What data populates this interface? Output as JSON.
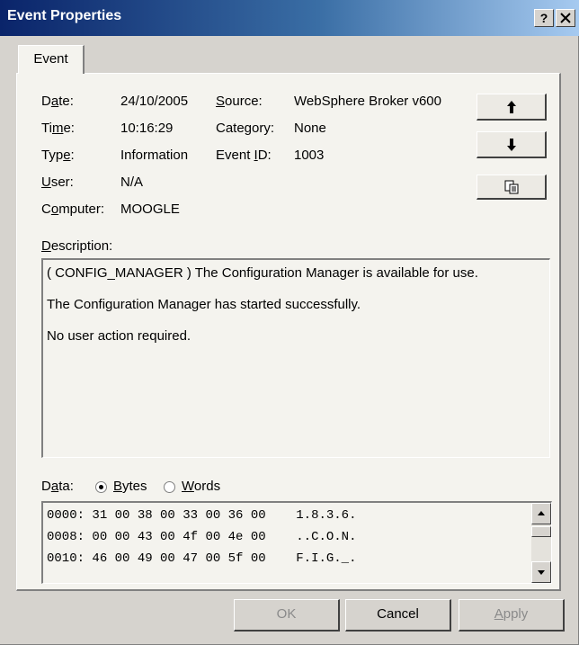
{
  "window": {
    "title": "Event Properties",
    "help_label": "?",
    "close_label": "✕"
  },
  "tab": {
    "label": "Event"
  },
  "fields": {
    "date_label": "Date:",
    "date_value": "24/10/2005",
    "time_label": "Time:",
    "time_value": "10:16:29",
    "type_label": "Type:",
    "type_value": "Information",
    "user_label": "User:",
    "user_value": "N/A",
    "computer_label": "Computer:",
    "computer_value": "MOOGLE",
    "source_label": "Source:",
    "source_value": "WebSphere Broker v600",
    "category_label": "Category:",
    "category_value": "None",
    "eventid_label": "Event ID:",
    "eventid_value": "1003"
  },
  "nav": {
    "up_icon": "arrow-up-icon",
    "down_icon": "arrow-down-icon",
    "copy_icon": "copy-icon"
  },
  "description": {
    "label": "Description:",
    "lines": [
      "( CONFIG_MANAGER ) The Configuration Manager is available for use.",
      "The Configuration Manager has started successfully.",
      "No user action required."
    ]
  },
  "data": {
    "label": "Data:",
    "bytes_label": "Bytes",
    "words_label": "Words",
    "selected": "Bytes",
    "rows": [
      {
        "offset": "0000:",
        "hex": "31 00 38 00 33 00 36 00",
        "ascii": "1.8.3.6."
      },
      {
        "offset": "0008:",
        "hex": "00 00 43 00 4f 00 4e 00",
        "ascii": "..C.O.N."
      },
      {
        "offset": "0010:",
        "hex": "46 00 49 00 47 00 5f 00",
        "ascii": "F.I.G._."
      }
    ]
  },
  "buttons": {
    "ok": "OK",
    "cancel": "Cancel",
    "apply": "Apply"
  }
}
